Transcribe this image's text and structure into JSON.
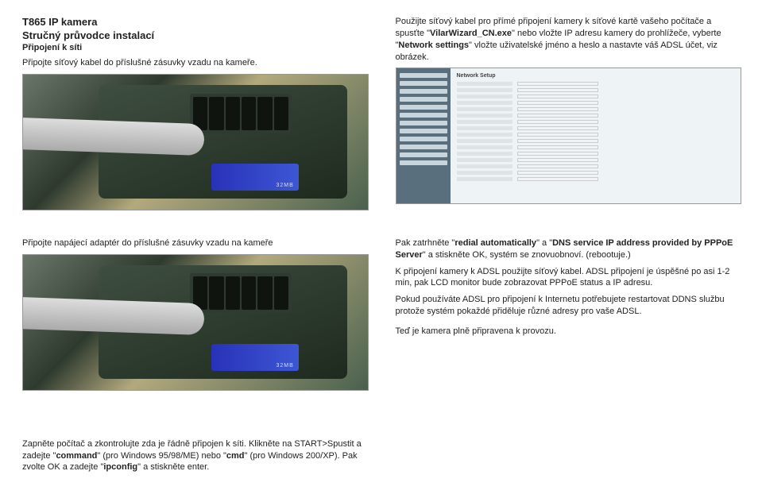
{
  "top": {
    "left": {
      "title": "T865 IP kamera",
      "subtitle": "Stručný průvodce instalací",
      "heading": "Připojení k síti",
      "p1": "Připojte síťový kabel do příslušné zásuvky  vzadu na kameře."
    },
    "right": {
      "p1_a": "Použijte síťový kabel pro přímé připojení kamery k síťové kartě vašeho počítače a spusťte \"",
      "p1_b": "VilarWizard_CN.exe",
      "p1_c": "\" nebo vložte IP adresu kamery do prohlížeče, vyberte \"",
      "p1_d": "Network settings",
      "p1_e": "\" vložte uživatelské jméno a heslo a nastavte váš ADSL účet, viz obrázek.",
      "net_title": "Network Setup"
    }
  },
  "middle": {
    "left": {
      "p1": "Připojte napájecí adaptér do příslušné zásuvky vzadu na kameře"
    },
    "right": {
      "p1_a": "Pak zatrhněte \"",
      "p1_b": "redial automatically",
      "p1_c": "\" a \"",
      "p1_d": "DNS service IP address provided by PPPoE Server",
      "p1_e": "\" a stiskněte OK, systém se znovuobnoví. (rebootuje.)",
      "p2": "K připojení kamery k ADSL použijte síťový kabel. ADSL připojení je úspěšné po asi 1-2 min, pak LCD monitor bude zobrazovat PPPoE status a IP adresu.",
      "p3": "Pokud používáte ADSL pro připojení k Internetu potřebujete restartovat DDNS službu protože systém pokaždé přiděluje různé adresy pro vaše ADSL.",
      "p4": "Teď je kamera plně připravena k provozu."
    }
  },
  "bottom": {
    "p1_a": "Zapněte počítač a zkontrolujte zda je řádně připojen k síti. Klikněte na START>Spustit a zadejte \"",
    "p1_b": "command",
    "p1_c": "\"  (pro Windows 95/98/ME) nebo \"",
    "p1_d": "cmd",
    "p1_e": "\" (pro Windows 200/XP). Pak zvolte OK a zadejte \"",
    "p1_f": "ipconfig",
    "p1_g": "\" a stiskněte enter."
  }
}
